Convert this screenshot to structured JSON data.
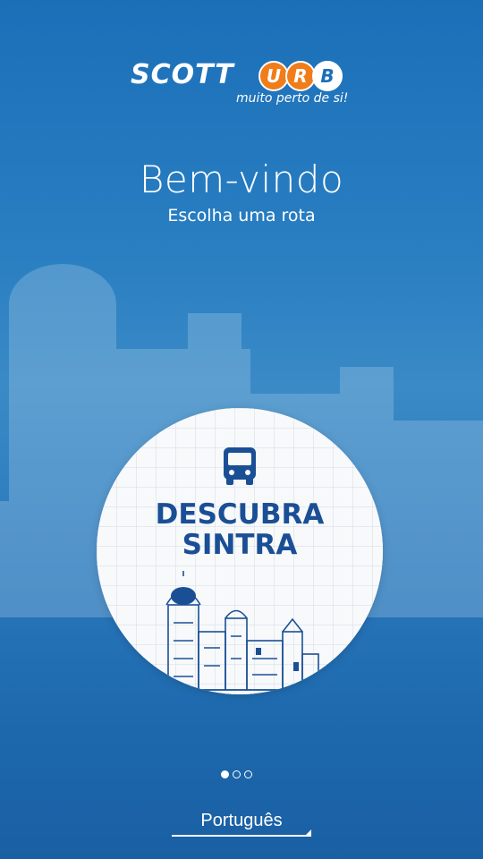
{
  "brand": {
    "wordmark": "SCOTT",
    "letters": [
      "U",
      "R",
      "B"
    ],
    "tagline": "muito perto de si!"
  },
  "header": {
    "title": "Bem-vindo",
    "subtitle": "Escolha uma rota"
  },
  "carousel": {
    "current_card": {
      "icon": "bus-icon",
      "name_line1": "DESCUBRA",
      "name_line2": "SINTRA"
    },
    "page_count": 3,
    "active_page": 1
  },
  "language": {
    "selected": "Português"
  },
  "colors": {
    "accent": "#1b6fb8",
    "route_text": "#1b4f95",
    "brand_orange": "#f07d1a"
  }
}
